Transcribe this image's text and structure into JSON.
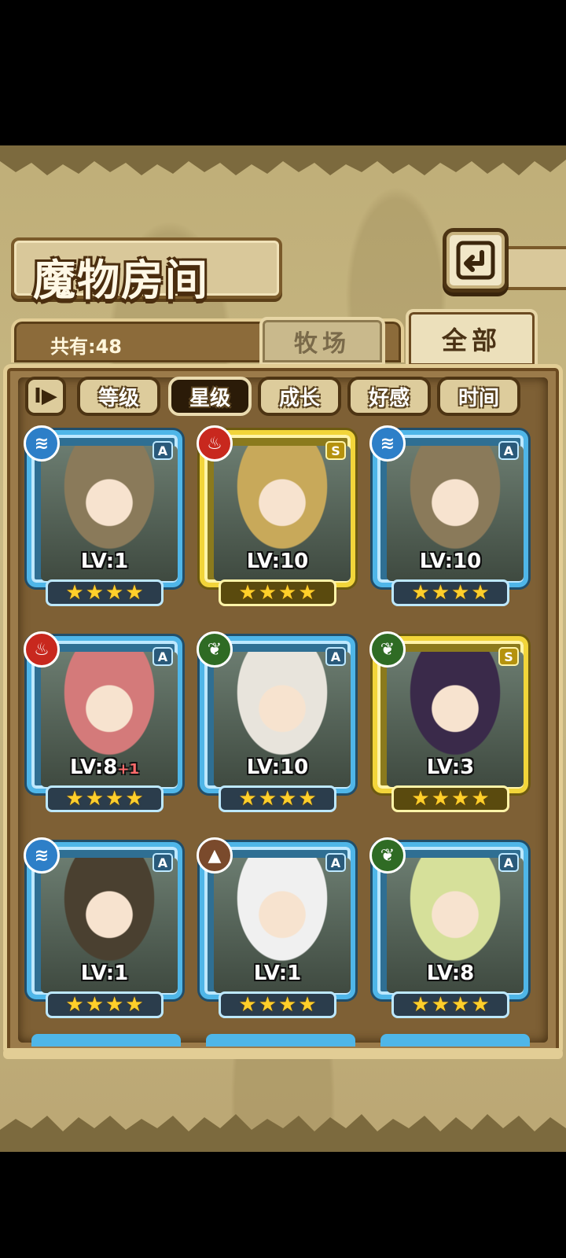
{
  "screen": {
    "title": "魔物房间"
  },
  "header": {
    "count_label": "共有:48"
  },
  "tabs": [
    {
      "label": "牧场",
      "active": false
    },
    {
      "label": "全部",
      "active": true
    }
  ],
  "sort": {
    "toggle_label": "I▶",
    "buttons": [
      {
        "label": "等级",
        "active": false
      },
      {
        "label": "星级",
        "active": true
      },
      {
        "label": "成长",
        "active": false
      },
      {
        "label": "好感",
        "active": false
      },
      {
        "label": "时间",
        "active": false
      }
    ]
  },
  "monsters": [
    {
      "level": "LV:1",
      "bonus": "",
      "rank": "A",
      "element": "water",
      "stars": 4
    },
    {
      "level": "LV:10",
      "bonus": "",
      "rank": "S",
      "element": "fire",
      "stars": 4
    },
    {
      "level": "LV:10",
      "bonus": "",
      "rank": "A",
      "element": "water",
      "stars": 4
    },
    {
      "level": "LV:8",
      "bonus": "+1",
      "rank": "A",
      "element": "fire",
      "stars": 4
    },
    {
      "level": "LV:10",
      "bonus": "",
      "rank": "A",
      "element": "wood",
      "stars": 4
    },
    {
      "level": "LV:3",
      "bonus": "",
      "rank": "S",
      "element": "wood",
      "stars": 4
    },
    {
      "level": "LV:1",
      "bonus": "",
      "rank": "A",
      "element": "water",
      "stars": 4
    },
    {
      "level": "LV:1",
      "bonus": "",
      "rank": "A",
      "element": "earth",
      "stars": 4
    },
    {
      "level": "LV:8",
      "bonus": "",
      "rank": "A",
      "element": "wood",
      "stars": 4
    }
  ],
  "colors": {
    "water": "#2d7fc8",
    "fire": "#c8281e",
    "wood": "#2f6b24",
    "earth": "#7a4a2c",
    "rank_a_frame": "#4fb6e8",
    "rank_s_frame": "#f2d53a",
    "star": "#ffcf2a"
  },
  "icons": {
    "water": "water-icon",
    "fire": "fire-icon",
    "wood": "leaf-icon",
    "earth": "mountain-icon",
    "back": "return-arrow-icon",
    "star": "star-icon"
  }
}
